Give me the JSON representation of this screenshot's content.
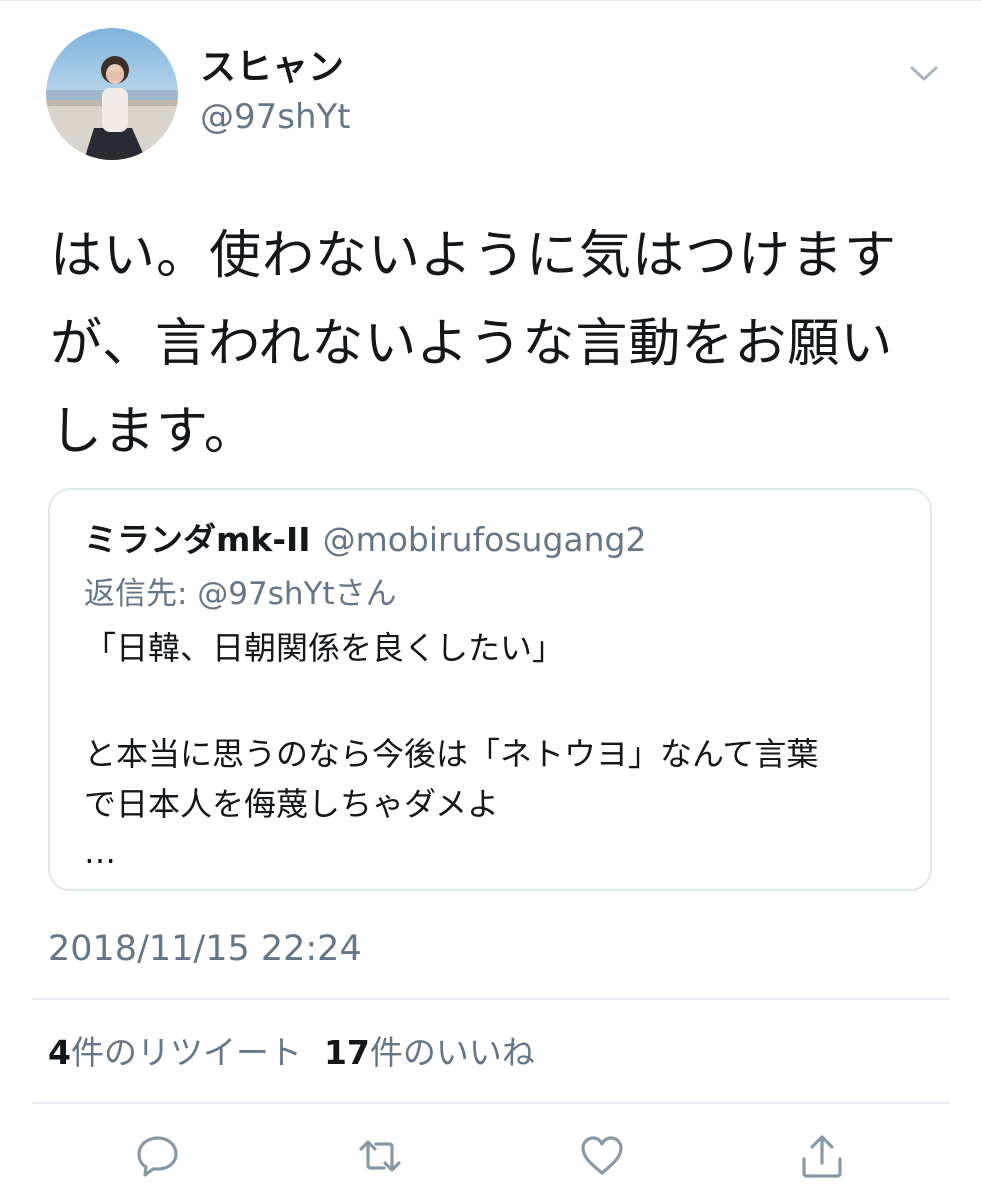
{
  "author": {
    "display_name": "スヒャン",
    "handle": "@97shYt"
  },
  "tweet": {
    "lines": [
      "はい。使わないように気はつけます",
      "が、言われないような言動をお願い",
      "します。"
    ]
  },
  "quoted_tweet": {
    "display_name": "ミランダmk-II",
    "handle": "@mobirufosugang2",
    "reply_to": "返信先: @97shYtさん",
    "lines": [
      "「日韓、日朝関係を良くしたい」",
      "と本当に思うのなら今後は「ネトウヨ」なんて言葉",
      "で日本人を侮蔑しちゃダメよ",
      "…"
    ]
  },
  "timestamp": "2018/11/15 22:24",
  "stats": {
    "retweets_count": "4",
    "retweets_label": "件のリツイート",
    "likes_count": "17",
    "likes_label": "件のいいね"
  },
  "icons": {
    "menu": "chevron-down-icon",
    "reply": "reply-icon",
    "retweet": "retweet-icon",
    "like": "heart-icon",
    "share": "share-icon"
  },
  "colors": {
    "text": "#14171a",
    "secondary": "#657786",
    "border": "#e1e8ed"
  }
}
